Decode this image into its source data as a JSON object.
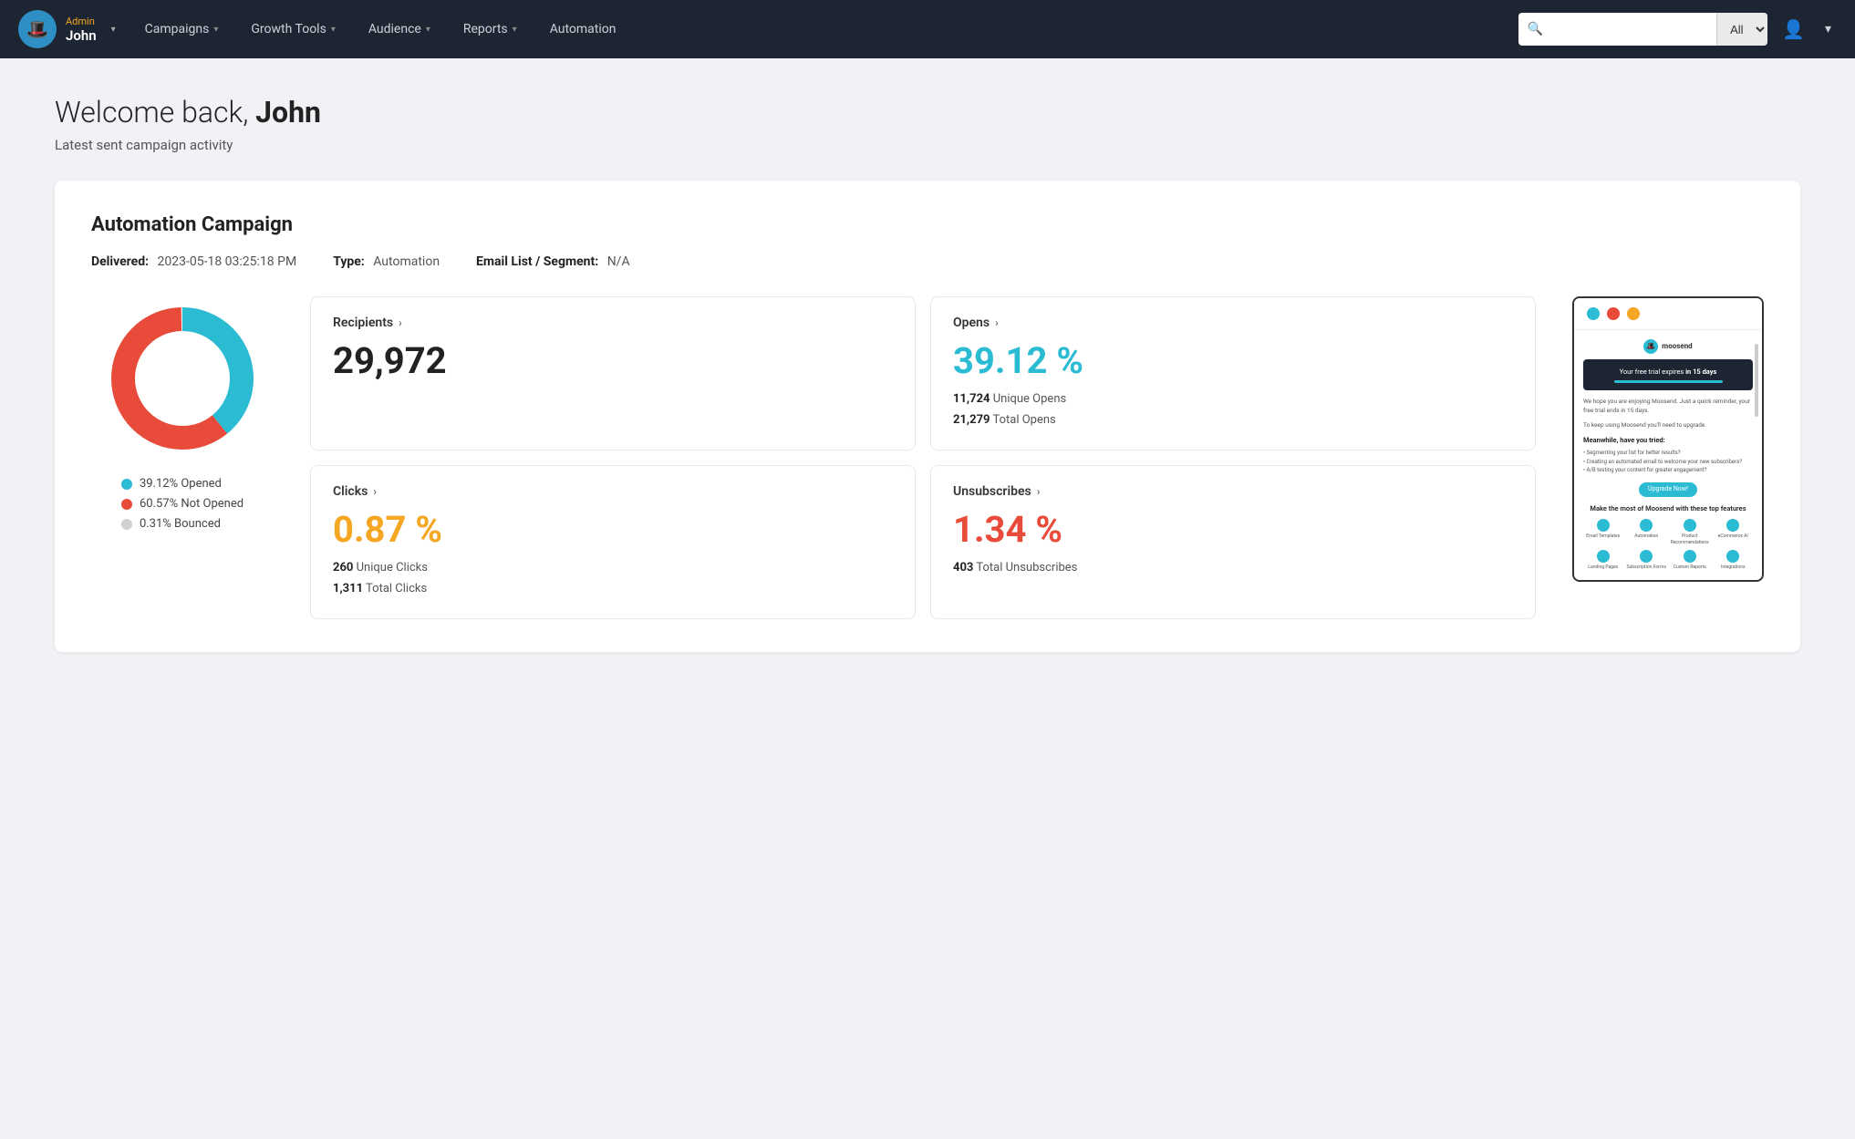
{
  "nav": {
    "role": "Admin",
    "username": "John",
    "items": [
      {
        "label": "Campaigns",
        "hasDropdown": true
      },
      {
        "label": "Growth Tools",
        "hasDropdown": true
      },
      {
        "label": "Audience",
        "hasDropdown": true
      },
      {
        "label": "Reports",
        "hasDropdown": true
      },
      {
        "label": "Automation",
        "hasDropdown": false
      }
    ],
    "search": {
      "placeholder": "",
      "filter_label": "All"
    }
  },
  "page": {
    "welcome_prefix": "Welcome back, ",
    "welcome_name": "John",
    "subtitle": "Latest sent campaign activity"
  },
  "campaign": {
    "title": "Automation Campaign",
    "delivered_label": "Delivered:",
    "delivered_value": "2023-05-18 03:25:18 PM",
    "type_label": "Type:",
    "type_value": "Automation",
    "email_list_label": "Email List / Segment:",
    "email_list_value": "N/A",
    "donut": {
      "opened_pct": 39.12,
      "not_opened_pct": 60.57,
      "bounced_pct": 0.31,
      "legend": [
        {
          "color": "#2bbcd4",
          "label": "39.12% Opened"
        },
        {
          "color": "#e84b3a",
          "label": "60.57% Not Opened"
        },
        {
          "color": "#d0d0d0",
          "label": "0.31% Bounced"
        }
      ]
    },
    "stats": {
      "recipients": {
        "label": "Recipients",
        "value": "29,972"
      },
      "opens": {
        "label": "Opens",
        "pct": "39.12 %",
        "unique_label": "Unique Opens",
        "unique_value": "11,724",
        "total_label": "Total Opens",
        "total_value": "21,279"
      },
      "clicks": {
        "label": "Clicks",
        "pct": "0.87 %",
        "unique_label": "Unique Clicks",
        "unique_value": "260",
        "total_label": "Total Clicks",
        "total_value": "1,311"
      },
      "unsubscribes": {
        "label": "Unsubscribes",
        "pct": "1.34 %",
        "total_label": "Total Unsubscribes",
        "total_value": "403"
      }
    },
    "preview": {
      "banner_text": "Your free trial expires in 15 days",
      "logo_text": "moosend",
      "body_para1": "We hope you are enjoying Moosend. Just a quick reminder, your free trial ends in 15 days.",
      "body_para2": "To keep using Moosend you'll need to upgrade.",
      "meanwhile_heading": "Meanwhile, have you tried:",
      "list_items": [
        "• Segmenting your list for better results?",
        "• Creating an automated email to welcome your new subscribers?",
        "• A/B testing your content for greater engagement?"
      ],
      "upgrade_btn": "Upgrade Now!",
      "features_title": "Make the most of Moosend with these top features",
      "feature_icons": [
        {
          "label": "Email Templates"
        },
        {
          "label": "Automation"
        },
        {
          "label": "Product Recommendations"
        },
        {
          "label": "eCommerce AI"
        },
        {
          "label": "Landing Pages"
        },
        {
          "label": "Subscription Forms"
        },
        {
          "label": "Custom Reports"
        },
        {
          "label": "Integrations"
        }
      ]
    }
  }
}
